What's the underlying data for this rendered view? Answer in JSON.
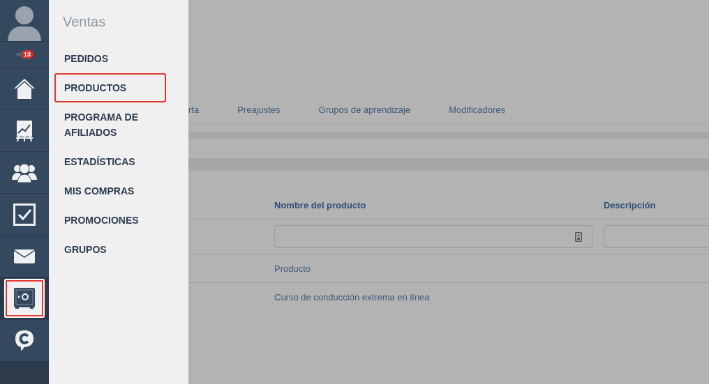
{
  "rail": [
    {
      "kind": "avatar",
      "selected": false
    },
    {
      "kind": "notifications",
      "badge": "13",
      "selected": false
    },
    {
      "kind": "home",
      "selected": false
    },
    {
      "kind": "chart",
      "selected": false
    },
    {
      "kind": "people",
      "selected": false
    },
    {
      "kind": "check",
      "selected": false
    },
    {
      "kind": "mail",
      "selected": false
    },
    {
      "kind": "safe",
      "selected": true
    },
    {
      "kind": "chat",
      "selected": false
    }
  ],
  "menu": {
    "title": "Ventas",
    "items": [
      {
        "label": "PEDIDOS",
        "highlighted": false
      },
      {
        "label": "PRODUCTOS",
        "highlighted": true
      },
      {
        "label": "PROGRAMA DE AFILIADOS",
        "highlighted": false
      },
      {
        "label": "ESTADÍSTICAS",
        "highlighted": false
      },
      {
        "label": "MIS COMPRAS",
        "highlighted": false
      },
      {
        "label": "PROMOCIONES",
        "highlighted": false
      },
      {
        "label": "GRUPOS",
        "highlighted": false
      }
    ]
  },
  "tabs": [
    "rta",
    "Preajustes",
    "Grupos de aprendizaje",
    "Modificadores"
  ],
  "table": {
    "columns": [
      "Nombre del producto",
      "Descripción"
    ],
    "rows": [
      [
        "Producto"
      ],
      [
        "Curso de conducción extrema en línea"
      ]
    ]
  }
}
